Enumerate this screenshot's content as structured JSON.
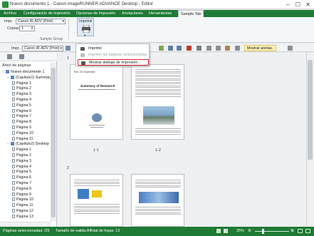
{
  "window": {
    "title": "Nuevo documento 1 - Canon imageRUNNER ADVANCE Desktop - Editor",
    "controls": [
      "–",
      "☐",
      "✕"
    ]
  },
  "ribbon_tabs": [
    "Archivo",
    "Configuración de impresión",
    "Opciones de impresión",
    "Anotaciones",
    "Herramientas",
    "Sample Tab"
  ],
  "ribbon": {
    "printer_label": "Impr.",
    "printer_value": "Canon iR-ADV (Print)",
    "copies_label": "Copias",
    "copies_value": "1",
    "print_button": "Imprimir",
    "group_label": "Sample Group"
  },
  "menu": {
    "items": [
      {
        "label": "Imprimir",
        "enabled": true
      },
      {
        "label": "Imprimir las páginas seleccionadas",
        "enabled": false
      },
      {
        "label": "Mostrar diálogo de impresión...",
        "enabled": true,
        "highlighted": true
      }
    ]
  },
  "toolbar": {
    "printer_label": "Impr.",
    "printer_value": "Canon iR-ADV (Print)",
    "show_annotations": "Mostrar anotac."
  },
  "tree": {
    "heading": "Árbol de páginas",
    "rows": [
      {
        "label": "Nuevo documento 1",
        "indent": 0,
        "kind": "doc",
        "toggle": "−"
      },
      {
        "label": "(Capítulo1) Summary",
        "indent": 1,
        "kind": "chapter",
        "toggle": "−"
      },
      {
        "label": "Página 1",
        "indent": 2,
        "kind": "page"
      },
      {
        "label": "Página 2",
        "indent": 2,
        "kind": "page"
      },
      {
        "label": "Página 3",
        "indent": 2,
        "kind": "page"
      },
      {
        "label": "Página 4",
        "indent": 2,
        "kind": "page"
      },
      {
        "label": "Página 5",
        "indent": 2,
        "kind": "page"
      },
      {
        "label": "Página 6",
        "indent": 2,
        "kind": "page"
      },
      {
        "label": "Página 7",
        "indent": 2,
        "kind": "page"
      },
      {
        "label": "Página 8",
        "indent": 2,
        "kind": "page"
      },
      {
        "label": "Página 9",
        "indent": 2,
        "kind": "page"
      },
      {
        "label": "Página 10",
        "indent": 2,
        "kind": "page"
      },
      {
        "label": "Página 11",
        "indent": 2,
        "kind": "page"
      },
      {
        "label": "(Capítulo2) Desktop",
        "indent": 1,
        "kind": "chapter",
        "toggle": "−"
      },
      {
        "label": "Página 1",
        "indent": 2,
        "kind": "page"
      },
      {
        "label": "Página 2",
        "indent": 2,
        "kind": "page"
      },
      {
        "label": "Página 3",
        "indent": 2,
        "kind": "page"
      },
      {
        "label": "Página 4",
        "indent": 2,
        "kind": "page"
      },
      {
        "label": "Página 5",
        "indent": 2,
        "kind": "page"
      },
      {
        "label": "Página 6",
        "indent": 2,
        "kind": "page"
      },
      {
        "label": "Página 7",
        "indent": 2,
        "kind": "page"
      },
      {
        "label": "Página 8",
        "indent": 2,
        "kind": "page"
      },
      {
        "label": "Página 9",
        "indent": 2,
        "kind": "page"
      },
      {
        "label": "Página 10",
        "indent": 2,
        "kind": "page"
      },
      {
        "label": "Página 11",
        "indent": 2,
        "kind": "page"
      },
      {
        "label": "Página 12",
        "indent": 2,
        "kind": "page"
      },
      {
        "label": "Página 13",
        "indent": 2,
        "kind": "page"
      }
    ]
  },
  "pages": {
    "p1": {
      "label": "1-1",
      "doc_title": "Summary of Research",
      "header": "Rev. 20 December"
    },
    "p2": {
      "label": "1-2"
    },
    "ch1": "1",
    "ch2": "2"
  },
  "status": {
    "selected": "Páginas seleccionadas: /25",
    "output_size": "Tamaño de salida:A4",
    "total_sheets": "Total de hojas: 13",
    "zoom": "25%"
  },
  "colors": {
    "accent": "#1e7a34",
    "highlight": "#e0202a"
  }
}
